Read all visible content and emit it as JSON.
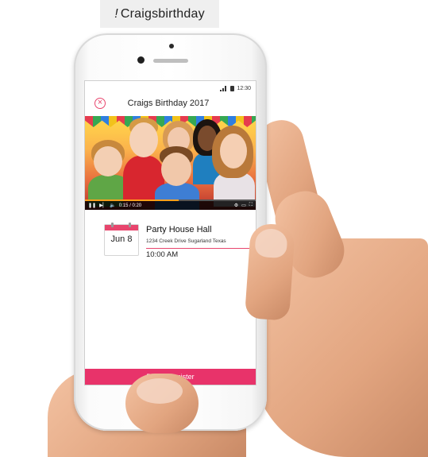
{
  "banner": {
    "prefix": "!",
    "text": "Craigsbirthday"
  },
  "status_bar": {
    "time": "12:30"
  },
  "header": {
    "title": "Craigs Birthday 2017",
    "close_icon": "close-icon"
  },
  "video": {
    "progress": 0.55,
    "time_label": "0:15 / 0:20"
  },
  "event": {
    "date": "Jun 8",
    "venue": "Party House Hall",
    "address": "1234 Creek Drive Sugarland Texas",
    "time": "10:00 AM"
  },
  "rsvp": {
    "label": "RSVP Register"
  },
  "colors": {
    "accent": "#e8336a",
    "accent_light": "#e8456d"
  }
}
